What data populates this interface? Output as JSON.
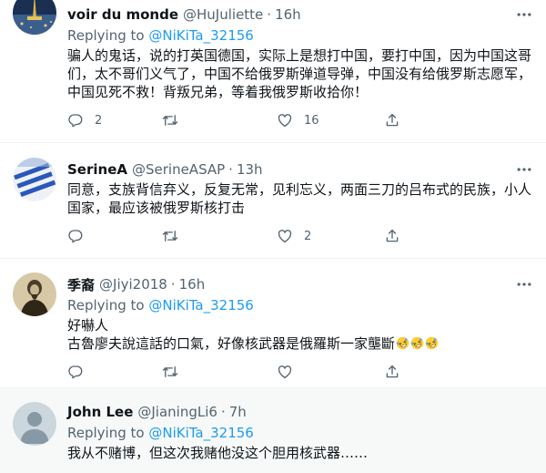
{
  "tweets": [
    {
      "name": "voir du monde",
      "handle": "@HuJuliette",
      "time": "16h",
      "replying_prefix": "Replying to ",
      "replying_handle": "@NiKiTa_32156",
      "text": "骗人的鬼话，说的打英国德国，实际上是想打中国，要打中国，因为中国这哥们，太不哥们义气了，中国不给俄罗斯弹道导弹，中国没有给俄罗斯志愿军，中国见死不救！背叛兄弟，等着我俄罗斯收拾你！",
      "replies": "2",
      "retweets": "",
      "likes": "16"
    },
    {
      "name": "SerineA",
      "handle": "@SerineASAP",
      "time": "13h",
      "text": "同意，支族背信弃义，反复无常，见利忘义，两面三刀的吕布式的民族，小人国家，最应该被俄罗斯核打击",
      "replies": "",
      "retweets": "",
      "likes": "2"
    },
    {
      "name": "季裔",
      "handle": "@Jiyi2018",
      "time": "16h",
      "replying_prefix": "Replying to ",
      "replying_handle": "@NiKiTa_32156",
      "text_line1": "好嚇人",
      "text_line2": "古魯廖夫說這話的口氣，好像核武器是俄羅斯一家壟斷",
      "emoji": "rolling-on-floor-laughing",
      "replies": "",
      "retweets": "",
      "likes": ""
    },
    {
      "name": "John Lee",
      "handle": "@JianingLi6",
      "time": "7h",
      "replying_prefix": "Replying to ",
      "replying_handle": "@NiKiTa_32156",
      "text": "我从不赌博，但这次我赌他没这个胆用核武器……"
    }
  ],
  "separator": "·",
  "colors": {
    "link": "#1d9bf0",
    "muted": "#536471",
    "highlight_bg": "#f7f9f9"
  }
}
